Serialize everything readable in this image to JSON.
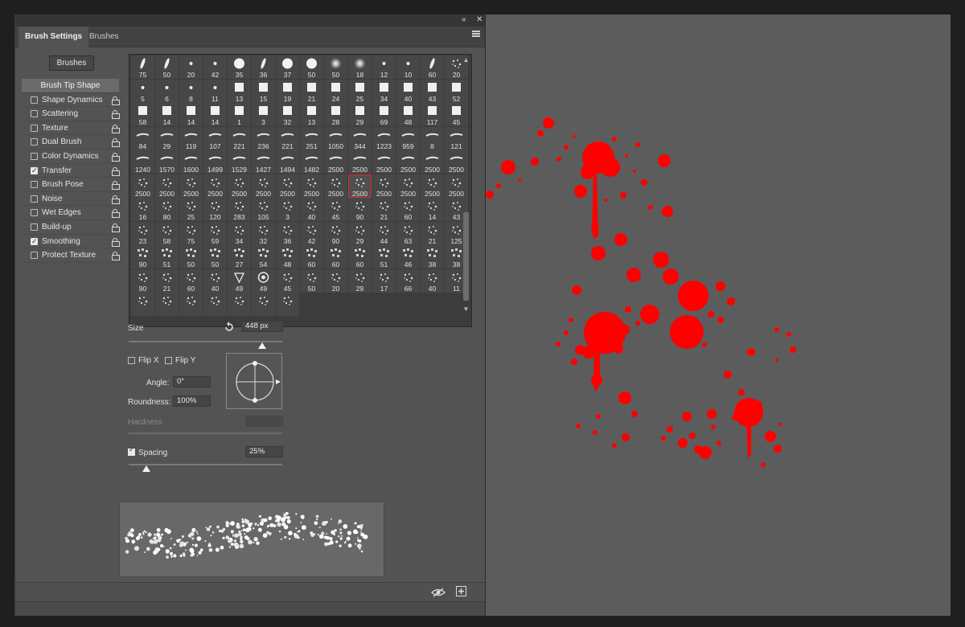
{
  "window": {
    "collapse_glyph": "«",
    "close_glyph": "✕"
  },
  "tabs": [
    {
      "label": "Brush Settings",
      "active": true
    },
    {
      "label": "Brushes",
      "active": false
    }
  ],
  "brushes_button": "Brushes",
  "options": [
    {
      "label": "Brush Tip Shape",
      "header": true
    },
    {
      "label": "Shape Dynamics",
      "checked": false
    },
    {
      "label": "Scattering",
      "checked": false
    },
    {
      "label": "Texture",
      "checked": false
    },
    {
      "label": "Dual Brush",
      "checked": false
    },
    {
      "label": "Color Dynamics",
      "checked": false
    },
    {
      "label": "Transfer",
      "checked": true
    },
    {
      "label": "Brush Pose",
      "checked": false
    },
    {
      "label": "Noise",
      "checked": false
    },
    {
      "label": "Wet Edges",
      "checked": false
    },
    {
      "label": "Build-up",
      "checked": false
    },
    {
      "label": "Smoothing",
      "checked": true
    },
    {
      "label": "Protect Texture",
      "checked": false
    }
  ],
  "brush_grid": {
    "rows": [
      [
        "75",
        "50",
        "20",
        "42",
        "35",
        "36",
        "37",
        "50",
        "50",
        "18",
        "12",
        "10",
        "60",
        "20"
      ],
      [
        "5",
        "6",
        "8",
        "11",
        "13",
        "15",
        "19",
        "21",
        "24",
        "25",
        "34",
        "40",
        "43",
        "52"
      ],
      [
        "58",
        "14",
        "14",
        "14",
        "1",
        "3",
        "32",
        "13",
        "28",
        "29",
        "69",
        "48",
        "117",
        "45"
      ],
      [
        "84",
        "29",
        "119",
        "107",
        "221",
        "236",
        "221",
        "251",
        "1050",
        "344",
        "1223",
        "959",
        "8",
        "121"
      ],
      [
        "1240",
        "1570",
        "1600",
        "1499",
        "1529",
        "1427",
        "1494",
        "1482",
        "2500",
        "2500",
        "2500",
        "2500",
        "2500",
        "2500"
      ],
      [
        "2500",
        "2500",
        "2500",
        "2500",
        "2500",
        "2500",
        "2500",
        "2500",
        "2500",
        "2500",
        "2500",
        "2500",
        "2500",
        "2500"
      ],
      [
        "16",
        "80",
        "25",
        "120",
        "283",
        "105",
        "3",
        "40",
        "45",
        "90",
        "21",
        "60",
        "14",
        "43"
      ],
      [
        "23",
        "58",
        "75",
        "59",
        "34",
        "32",
        "36",
        "42",
        "90",
        "29",
        "44",
        "63",
        "21",
        "125"
      ],
      [
        "90",
        "51",
        "50",
        "50",
        "27",
        "54",
        "48",
        "60",
        "60",
        "60",
        "51",
        "46",
        "38",
        "38"
      ],
      [
        "90",
        "21",
        "60",
        "40",
        "49",
        "49",
        "45",
        "50",
        "20",
        "29",
        "17",
        "66",
        "40",
        "11"
      ],
      [
        "",
        "",
        "",
        "",
        "",
        "",
        ""
      ]
    ],
    "selected": {
      "row": 5,
      "col": 9
    }
  },
  "size": {
    "label": "Size",
    "value": "448 px",
    "reset_icon": "reset-icon",
    "level": 0.62
  },
  "flip_x": {
    "label": "Flip X",
    "checked": false
  },
  "flip_y": {
    "label": "Flip Y",
    "checked": false
  },
  "angle": {
    "label": "Angle:",
    "value": "0°"
  },
  "roundness": {
    "label": "Roundness:",
    "value": "100%"
  },
  "hardness": {
    "label": "Hardness",
    "value": ""
  },
  "spacing": {
    "label": "Spacing",
    "value": "25%",
    "checked": true,
    "level": 0.12
  },
  "colors": {
    "panel": "#535353",
    "canvas": "#5c5c5c",
    "splatter": "#ff0000",
    "selection": "#e02a2a"
  },
  "bottom_icons": [
    "eye-toggle-icon",
    "new-preset-icon"
  ]
}
